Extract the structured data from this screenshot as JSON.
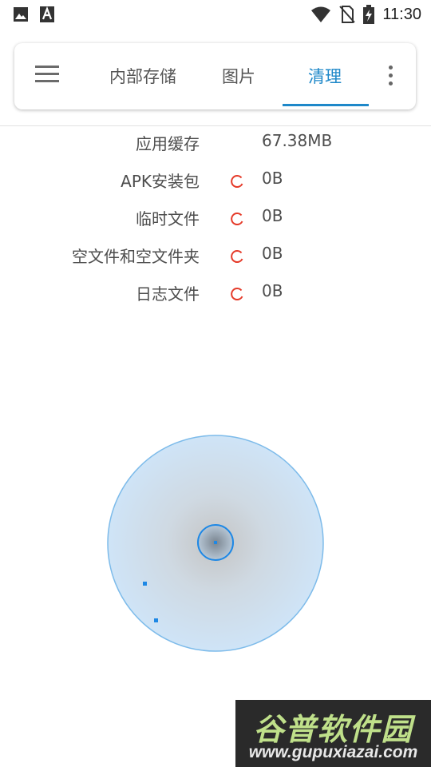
{
  "status_bar": {
    "time": "11:30",
    "left_icons": [
      "image-icon",
      "font-icon"
    ],
    "right_icons": [
      "wifi-icon",
      "no-sim-icon",
      "battery-charging-icon"
    ]
  },
  "toolbar": {
    "menu_icon": "hamburger-icon",
    "tabs": [
      {
        "label": "内部存储",
        "active": false
      },
      {
        "label": "图片",
        "active": false
      },
      {
        "label": "清理",
        "active": true
      }
    ],
    "more_icon": "more-vert-icon",
    "accent_color": "#1e88c9"
  },
  "clean_items": [
    {
      "label": "应用缓存",
      "value": "67.38MB",
      "loading": false
    },
    {
      "label": "APK安装包",
      "value": "0B",
      "loading": true
    },
    {
      "label": "临时文件",
      "value": "0B",
      "loading": true
    },
    {
      "label": "空文件和空文件夹",
      "value": "0B",
      "loading": true
    },
    {
      "label": "日志文件",
      "value": "0B",
      "loading": true
    }
  ],
  "spinner_color": "#e53b2a",
  "watermark": {
    "text": "谷普软件园",
    "url": "www.gupuxiazai.com"
  }
}
